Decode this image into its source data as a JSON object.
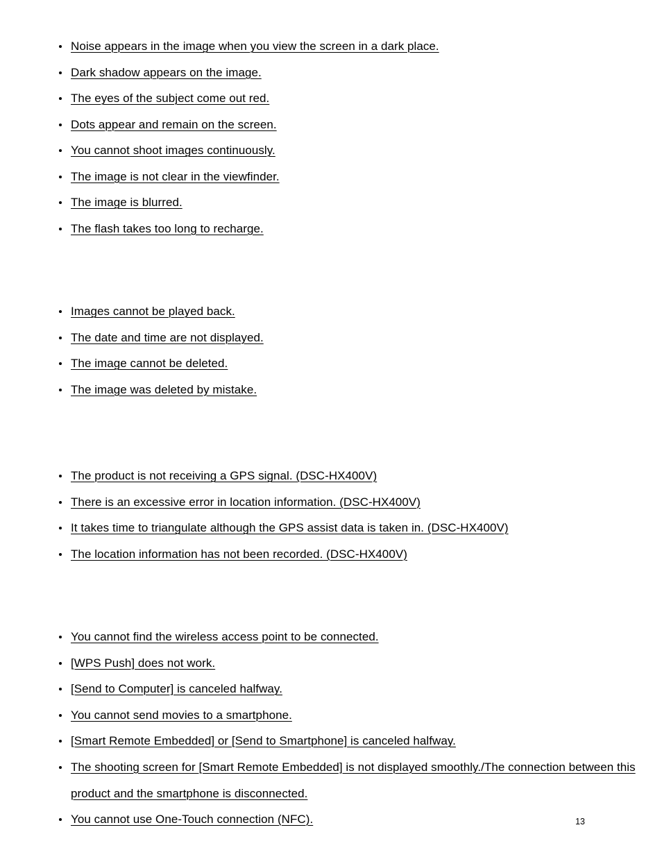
{
  "document": {
    "page_number": "13",
    "text_color": "#000000",
    "background_color": "#ffffff"
  },
  "sections": [
    {
      "heading": "",
      "items": [
        {
          "label": "Noise appears in the image when you view the screen in a dark place."
        },
        {
          "label": "Dark shadow appears on the image."
        },
        {
          "label": "The eyes of the subject come out red."
        },
        {
          "label": "Dots appear and remain on the screen."
        },
        {
          "label": "You cannot shoot images continuously."
        },
        {
          "label": "The image is not clear in the viewfinder."
        },
        {
          "label": "The image is blurred."
        },
        {
          "label": "The flash takes too long to recharge."
        }
      ]
    },
    {
      "heading": "",
      "items": [
        {
          "label": "Images cannot be played back."
        },
        {
          "label": "The date and time are not displayed."
        },
        {
          "label": "The image cannot be deleted."
        },
        {
          "label": "The image was deleted by mistake."
        }
      ]
    },
    {
      "heading": "",
      "items": [
        {
          "label": "The product is not receiving a GPS signal. (DSC-HX400V)"
        },
        {
          "label": "There is an excessive error in location information. (DSC-HX400V)"
        },
        {
          "label": "It takes time to triangulate although the GPS assist data is taken in. (DSC-HX400V)"
        },
        {
          "label": "The location information has not been recorded. (DSC-HX400V)"
        }
      ]
    },
    {
      "heading": "",
      "items": [
        {
          "label": "You cannot find the wireless access point to be connected."
        },
        {
          "label": "[WPS Push] does not work."
        },
        {
          "label": "[Send to Computer] is canceled halfway."
        },
        {
          "label": "You cannot send movies to a smartphone."
        },
        {
          "label": "[Smart Remote Embedded] or [Send to Smartphone] is canceled halfway."
        },
        {
          "label": "The shooting screen for [Smart Remote Embedded] is not displayed smoothly./The connection between this product and the smartphone is disconnected.",
          "wraps": true
        },
        {
          "label": "You cannot use One-Touch connection (NFC)."
        }
      ]
    }
  ]
}
